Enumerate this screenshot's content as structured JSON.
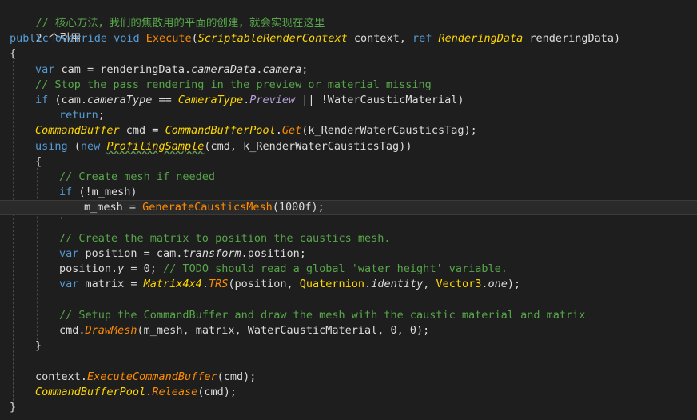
{
  "code": {
    "comment_cn": "// 核心方法，我们的焦散用的平面的创建，就会实现在这里",
    "references": "2 个引用",
    "sig_public": "public",
    "sig_override": "override",
    "sig_void": "void",
    "sig_name": "Execute",
    "sig_p1_type": "ScriptableRenderContext",
    "sig_p1_name": " context, ",
    "sig_ref": "ref",
    "sig_p2_type": "RenderingData",
    "sig_p2_name": " renderingData)",
    "brace_open": "{",
    "brace_close": "}",
    "l_var": "var",
    "l_cam_a": " cam = renderingData.",
    "l_cam_b": "cameraData",
    "l_cam_c": ".",
    "l_cam_d": "camera",
    "l_cam_e": ";",
    "l_comment1": "// Stop the pass rendering in the preview or material missing",
    "l_if": "if",
    "l_if_a": " (cam.",
    "l_if_b": "cameraType",
    "l_if_c": " == ",
    "l_if_d": "CameraType",
    "l_if_e": ".",
    "l_if_f": "Preview",
    "l_if_g": " || !WaterCausticMaterial)",
    "l_return": "return",
    "l_semi": ";",
    "l_cb_type": "CommandBuffer",
    "l_cb_a": " cmd = ",
    "l_cb_pool": "CommandBufferPool",
    "l_cb_dot": ".",
    "l_cb_get": "Get",
    "l_cb_b": "(k_RenderWaterCausticsTag);",
    "l_using": "using",
    "l_using_a": " (",
    "l_new": "new",
    "l_using_b": " ",
    "l_profiling": "ProfilingSample",
    "l_using_c": "(cmd, k_RenderWaterCausticsTag))",
    "l_comment2": "// Create mesh if needed",
    "l_if2_b": " (!m_mesh)",
    "l_mesh_a": "m_mesh = ",
    "l_mesh_fn": "GenerateCausticsMesh",
    "l_mesh_b": "(1000f);",
    "l_comment3": "// Create the matrix to position the caustics mesh.",
    "l_pos_a": " position = cam.",
    "l_pos_b": "transform",
    "l_pos_c": ".position;",
    "l_posy_a": "position.",
    "l_posy_b": "y",
    "l_posy_c": " = 0; ",
    "l_posy_comment": "// TODO should read a global 'water height' variable.",
    "l_mat_a": " matrix = ",
    "l_mat_type": "Matrix4x4",
    "l_mat_dot": ".",
    "l_mat_trs": "TRS",
    "l_mat_b": "(position, ",
    "l_quat": "Quaternion",
    "l_mat_c": ".",
    "l_ident": "identity",
    "l_mat_d": ", ",
    "l_vec3": "Vector3",
    "l_mat_e": ".",
    "l_one": "one",
    "l_mat_f": ");",
    "l_comment4": "// Setup the CommandBuffer and draw the mesh with the caustic material and matrix",
    "l_draw_a": "cmd.",
    "l_draw_fn": "DrawMesh",
    "l_draw_b": "(m_mesh, matrix, WaterCausticMaterial, 0, 0);",
    "l_ctx_a": "context.",
    "l_ctx_fn": "ExecuteCommandBuffer",
    "l_ctx_b": "(cmd);",
    "l_rel_pool": "CommandBufferPool",
    "l_rel_dot": ".",
    "l_rel_fn": "Release",
    "l_rel_b": "(cmd);"
  },
  "colors": {
    "background": "#1e1e1e",
    "keyword": "#569cd6",
    "comment": "#57a64a",
    "type": "#ffd700",
    "method": "#ff8c00",
    "text": "#dcdcdc"
  }
}
